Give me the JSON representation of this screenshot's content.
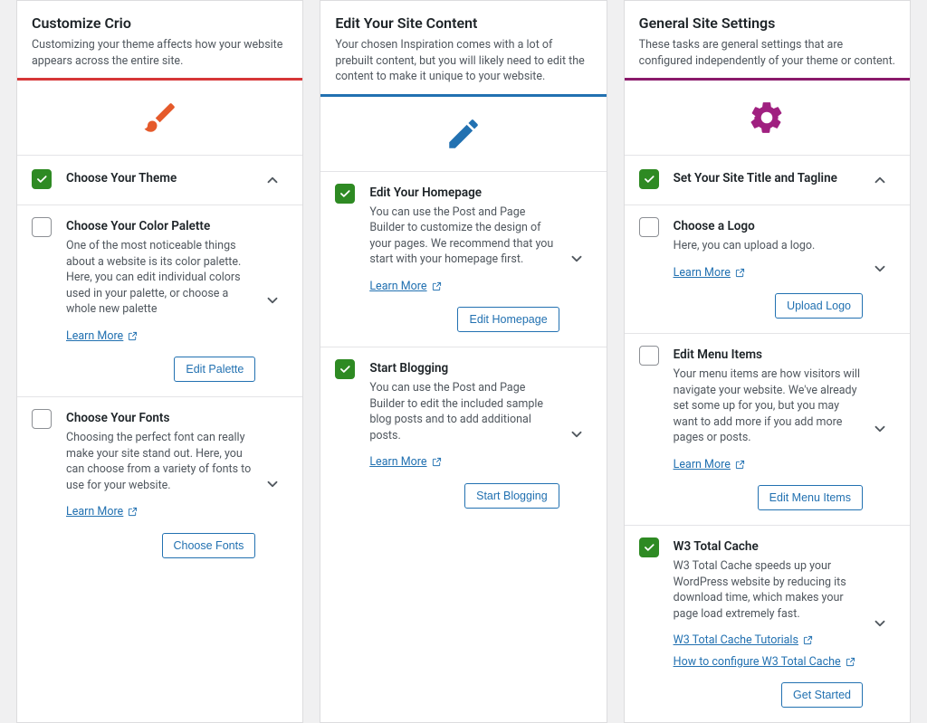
{
  "columns": [
    {
      "title": "Customize Crio",
      "desc": "Customizing your theme affects how your website appears across the entire site.",
      "tasks": [
        {
          "checked": true,
          "heading": true,
          "title": "Choose Your Theme",
          "desc": "",
          "links": [],
          "button": "",
          "expandUp": true
        },
        {
          "checked": false,
          "heading": false,
          "title": "Choose Your Color Palette",
          "desc": "One of the most noticeable things about a website is its color palette. Here, you can edit individual colors used in your palette, or choose a whole new palette",
          "links": [
            {
              "label": "Learn More",
              "ext": true
            }
          ],
          "button": "Edit Palette",
          "expandUp": false
        },
        {
          "checked": false,
          "heading": false,
          "title": "Choose Your Fonts",
          "desc": "Choosing the perfect font can really make your site stand out. Here, you can choose from a variety of fonts to use for your website.",
          "links": [
            {
              "label": "Learn More",
              "ext": true
            }
          ],
          "button": "Choose Fonts",
          "expandUp": false
        }
      ]
    },
    {
      "title": "Edit Your Site Content",
      "desc": "Your chosen Inspiration comes with a lot of prebuilt content, but you will likely need to edit the content to make it unique to your website.",
      "tasks": [
        {
          "checked": true,
          "heading": false,
          "title": "Edit Your Homepage",
          "desc": "You can use the Post and Page Builder to customize the design of your pages. We recommend that you start with your homepage first.",
          "links": [
            {
              "label": "Learn More",
              "ext": true
            }
          ],
          "button": "Edit Homepage",
          "expandUp": false
        },
        {
          "checked": true,
          "heading": false,
          "title": "Start Blogging",
          "desc": "You can use the Post and Page Builder to edit the included sample blog posts and to add additional posts.",
          "links": [
            {
              "label": "Learn More",
              "ext": true
            }
          ],
          "button": "Start Blogging",
          "expandUp": false
        }
      ]
    },
    {
      "title": "General Site Settings",
      "desc": "These tasks are general settings that are configured independently of your theme or content.",
      "tasks": [
        {
          "checked": true,
          "heading": true,
          "title": "Set Your Site Title and Tagline",
          "desc": "",
          "links": [],
          "button": "",
          "expandUp": true
        },
        {
          "checked": false,
          "heading": false,
          "title": "Choose a Logo",
          "desc": "Here, you can upload a logo.",
          "links": [
            {
              "label": "Learn More",
              "ext": true
            }
          ],
          "button": "Upload Logo",
          "expandUp": false
        },
        {
          "checked": false,
          "heading": false,
          "title": "Edit Menu Items",
          "desc": "Your menu items are how visitors will navigate your website. We've already set some up for you, but you may want to add more if you add more pages or posts.",
          "links": [
            {
              "label": "Learn More",
              "ext": true
            }
          ],
          "button": "Edit Menu Items",
          "expandUp": false
        },
        {
          "checked": true,
          "heading": false,
          "title": "W3 Total Cache",
          "desc": "W3 Total Cache speeds up your WordPress website by reducing its download time, which makes your page load extremely fast.",
          "links": [
            {
              "label": "W3 Total Cache Tutorials",
              "ext": true
            },
            {
              "label": "How to configure W3 Total Cache",
              "ext": true
            }
          ],
          "button": "Get Started",
          "expandUp": false
        }
      ]
    }
  ]
}
